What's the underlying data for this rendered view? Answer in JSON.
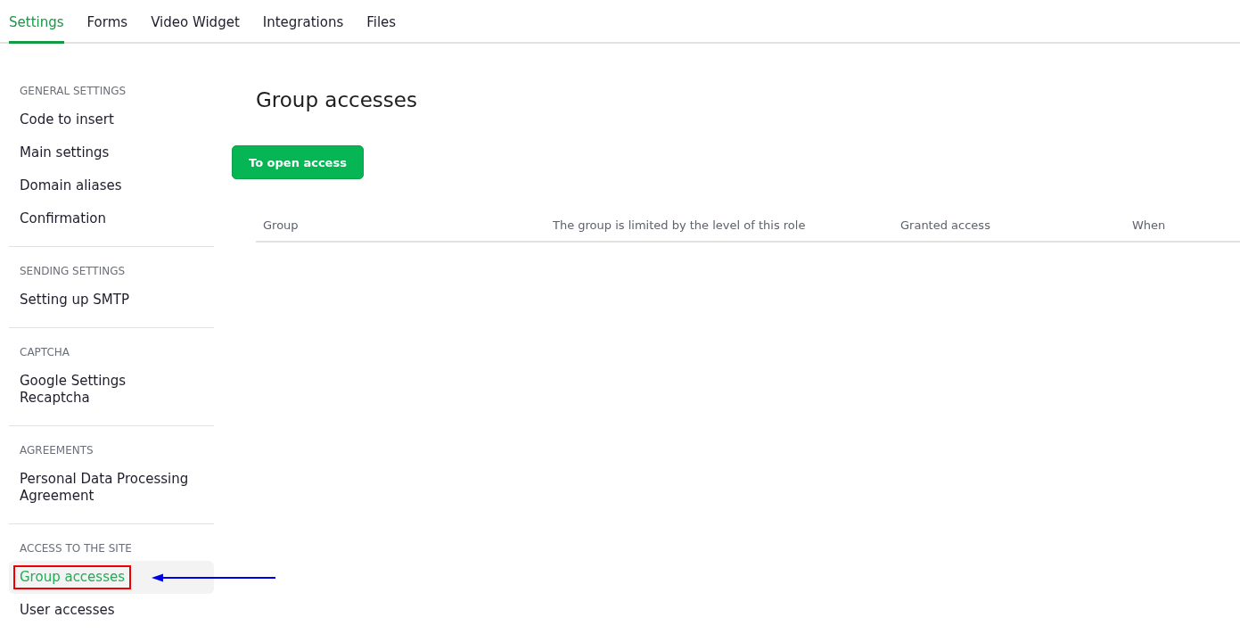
{
  "tabs": [
    {
      "label": "Settings",
      "selected": true
    },
    {
      "label": "Forms",
      "selected": false
    },
    {
      "label": "Video Widget",
      "selected": false
    },
    {
      "label": "Integrations",
      "selected": false
    },
    {
      "label": "Files",
      "selected": false
    }
  ],
  "sidebar": {
    "sections": [
      {
        "title": "GENERAL SETTINGS",
        "items": [
          {
            "label": "Code to insert",
            "selected": false,
            "highlighted": false
          },
          {
            "label": "Main settings",
            "selected": false,
            "highlighted": false
          },
          {
            "label": "Domain aliases",
            "selected": false,
            "highlighted": false
          },
          {
            "label": "Confirmation",
            "selected": false,
            "highlighted": false
          }
        ]
      },
      {
        "title": "SENDING SETTINGS",
        "items": [
          {
            "label": "Setting up SMTP",
            "selected": false,
            "highlighted": false
          }
        ]
      },
      {
        "title": "CAPTCHA",
        "items": [
          {
            "label": "Google Settings Recaptcha",
            "selected": false,
            "highlighted": false
          }
        ]
      },
      {
        "title": "AGREEMENTS",
        "items": [
          {
            "label": "Personal Data Processing Agreement",
            "selected": false,
            "highlighted": false
          }
        ]
      },
      {
        "title": "ACCESS TO THE SITE",
        "items": [
          {
            "label": "Group accesses",
            "selected": true,
            "highlighted": true
          },
          {
            "label": "User accesses",
            "selected": false,
            "highlighted": false
          }
        ]
      }
    ]
  },
  "main": {
    "title": "Group accesses",
    "button": "To open access",
    "table": {
      "columns": [
        "Group",
        "The group is limited by the level of this role",
        "Granted access",
        "When"
      ]
    }
  }
}
